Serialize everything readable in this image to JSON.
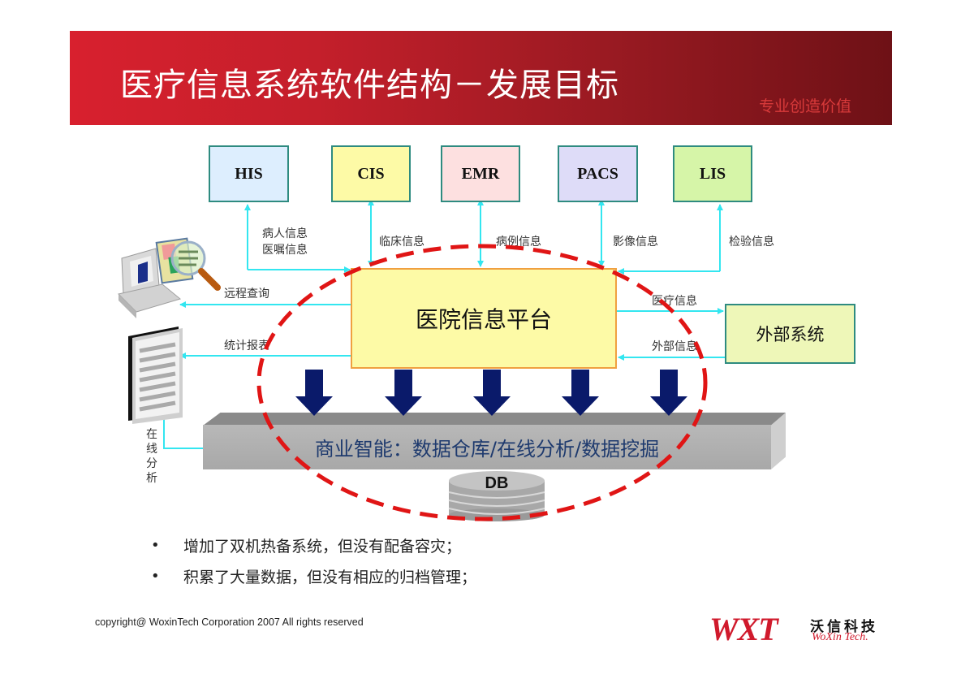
{
  "header": {
    "title": "医疗信息系统软件结构－发展目标",
    "slogan": "专业创造价值"
  },
  "systems": [
    {
      "label": "HIS",
      "color": "#ddeefe"
    },
    {
      "label": "CIS",
      "color": "#fdfaa6"
    },
    {
      "label": "EMR",
      "color": "#fde0e0"
    },
    {
      "label": "PACS",
      "color": "#dedcf8"
    },
    {
      "label": "LIS",
      "color": "#d6f5a8"
    }
  ],
  "links": {
    "his_line1": "病人信息",
    "his_line2": "医嘱信息",
    "cis": "临床信息",
    "emr": "病例信息",
    "pacs": "影像信息",
    "lis": "检验信息",
    "remote_query": "远程查询",
    "stat_report": "统计报表",
    "online_analysis": "在线分析",
    "medical_info": "医疗信息",
    "external_info": "外部信息"
  },
  "platform": {
    "label": "医院信息平台"
  },
  "external_system": {
    "label": "外部系统"
  },
  "bi_bar": {
    "label": "商业智能：数据仓库/在线分析/数据挖掘"
  },
  "database": {
    "label": "DB"
  },
  "bullets": [
    "增加了双机热备系统，但没有配备容灾；",
    "积累了大量数据，但没有相应的归档管理；"
  ],
  "footer": {
    "copyright": "copyright@ WoxinTech Corporation 2007 All rights reserved",
    "logo_mark": "WXT",
    "logo_cn": "沃信科技",
    "logo_en": "WoXin Tech."
  },
  "colors": {
    "connector": "#33e6f0",
    "highlight_ellipse": "#e01515",
    "down_arrow": "#0a1a6a"
  }
}
